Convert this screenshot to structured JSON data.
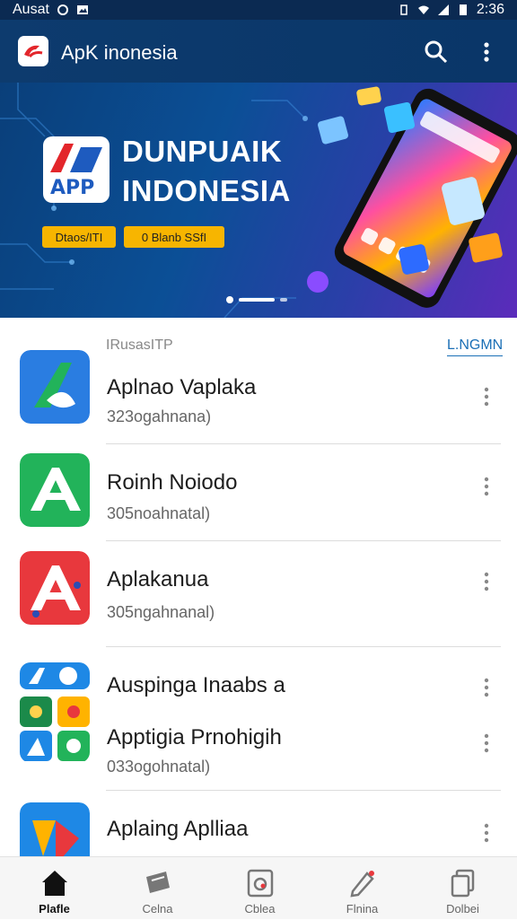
{
  "status_bar": {
    "carrier": "Ausat",
    "time": "2:36"
  },
  "app_bar": {
    "title": "ApK inonesia",
    "icons": [
      "app-logo-icon",
      "search-icon",
      "more-vert-icon"
    ]
  },
  "banner": {
    "heading_line1": "DUNPUAIK",
    "heading_line2": "INDONESIA",
    "logo_text": "APP",
    "button1": "Dtaos/ITI",
    "button2": "0 Blanb SSfI"
  },
  "list": {
    "header_left": "IRusasITP",
    "header_right": "L.NGMN",
    "items": [
      {
        "name": "Aplnao Vaplaka",
        "sub": "323ogahnana)",
        "icon": "blue-a-app-icon",
        "color": "#2a7de1"
      },
      {
        "name": "Roinh Noiodo",
        "sub": "305noahnatal)",
        "icon": "green-a-app-icon",
        "color": "#22b35a"
      },
      {
        "name": "Aplakanua",
        "sub": "305ngahnanal)",
        "icon": "red-a-app-icon",
        "color": "#e8383d"
      },
      {
        "name": "Auspinga Inaabs a",
        "sub": "",
        "icon": "multi-app-icon",
        "color": "#1e88e5"
      },
      {
        "name": "Apptigia Prnohigih",
        "sub": "033ogohnatal)",
        "icon": "",
        "color": ""
      },
      {
        "name": "Aplaing Aplliaa",
        "sub": "",
        "icon": "maps-app-icon",
        "color": "#1e88e5"
      }
    ]
  },
  "nav": {
    "items": [
      {
        "label": "Plafle",
        "icon": "home-icon",
        "active": true
      },
      {
        "label": "Celna",
        "icon": "tag-icon",
        "active": false
      },
      {
        "label": "Cblea",
        "icon": "camera-frame-icon",
        "active": false
      },
      {
        "label": "Flnina",
        "icon": "edit-pencil-icon",
        "active": false
      },
      {
        "label": "Dolbei",
        "icon": "copy-icon",
        "active": false
      }
    ]
  },
  "colors": {
    "app_bar": "#0d3b6e",
    "accent": "#1a6fb6",
    "banner_button": "#f7b500"
  }
}
